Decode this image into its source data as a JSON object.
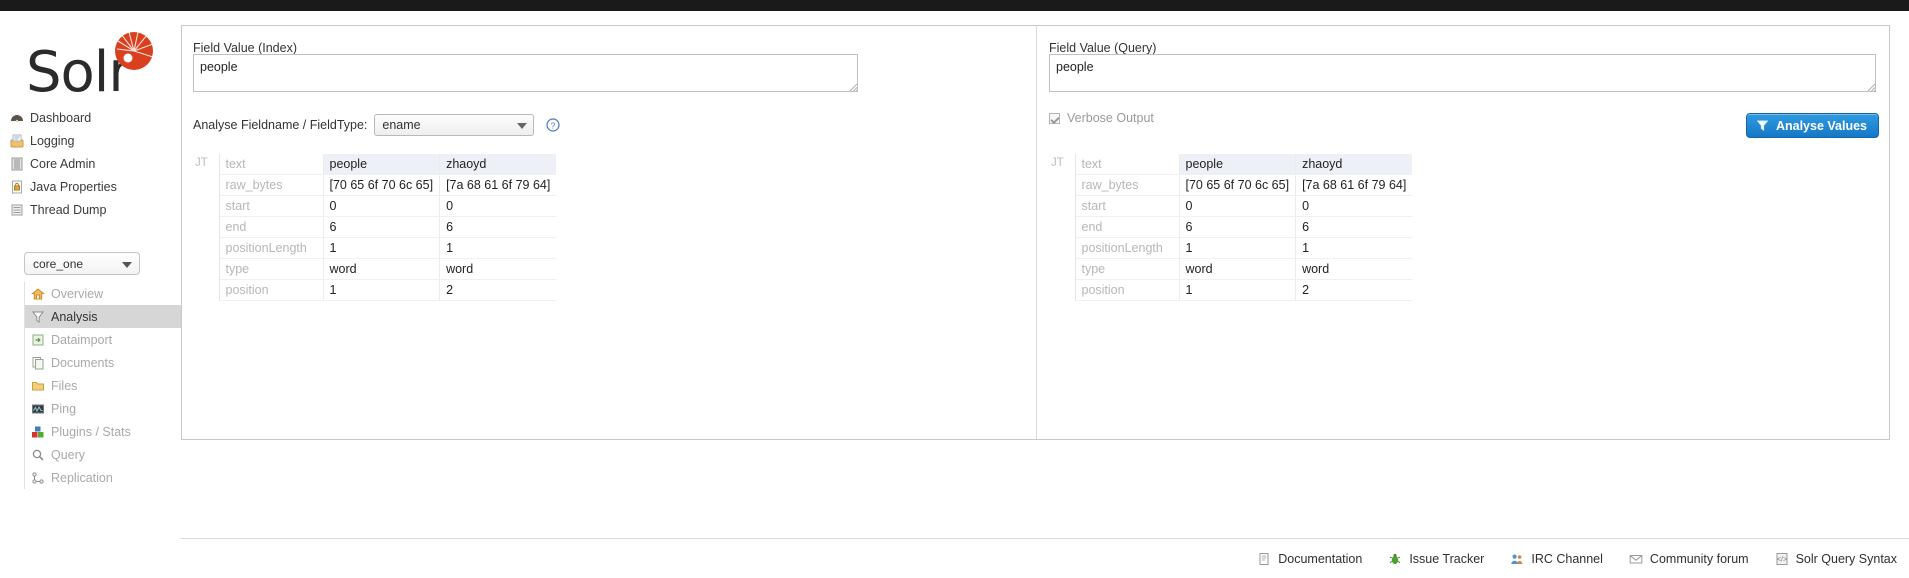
{
  "brand": {
    "name": "Solr",
    "accent": "#d9411e"
  },
  "sidebar": {
    "main_items": [
      {
        "label": "Dashboard",
        "icon": "dashboard-icon"
      },
      {
        "label": "Logging",
        "icon": "logging-icon"
      },
      {
        "label": "Core Admin",
        "icon": "core-admin-icon"
      },
      {
        "label": "Java Properties",
        "icon": "java-properties-icon"
      },
      {
        "label": "Thread Dump",
        "icon": "thread-dump-icon"
      }
    ],
    "core_selector": {
      "value": "core_one"
    },
    "core_items": [
      {
        "label": "Overview",
        "icon": "overview-icon",
        "active": false
      },
      {
        "label": "Analysis",
        "icon": "analysis-icon",
        "active": true
      },
      {
        "label": "Dataimport",
        "icon": "dataimport-icon",
        "active": false
      },
      {
        "label": "Documents",
        "icon": "documents-icon",
        "active": false
      },
      {
        "label": "Files",
        "icon": "files-icon",
        "active": false
      },
      {
        "label": "Ping",
        "icon": "ping-icon",
        "active": false
      },
      {
        "label": "Plugins / Stats",
        "icon": "plugins-icon",
        "active": false
      },
      {
        "label": "Query",
        "icon": "query-icon",
        "active": false
      },
      {
        "label": "Replication",
        "icon": "replication-icon",
        "active": false
      }
    ]
  },
  "index_panel": {
    "label": "Field Value (Index)",
    "value": "people",
    "fieldname_label": "Analyse Fieldname / FieldType:",
    "fieldtype_value": "ename",
    "help_icon": "help-icon"
  },
  "query_panel": {
    "label": "Field Value (Query)",
    "value": "people",
    "verbose_label": "Verbose Output",
    "verbose_checked": true,
    "analyse_button": "Analyse Values",
    "analyse_icon": "funnel-icon"
  },
  "analysis_result": {
    "jt_label": "JT",
    "row_keys": [
      "text",
      "raw_bytes",
      "start",
      "end",
      "positionLength",
      "type",
      "position"
    ],
    "tokens": [
      {
        "text": "people",
        "raw_bytes": "[70 65 6f 70 6c 65]",
        "start": "0",
        "end": "6",
        "positionLength": "1",
        "type": "word",
        "position": "1"
      },
      {
        "text": "zhaoyd",
        "raw_bytes": "[7a 68 61 6f 79 64]",
        "start": "0",
        "end": "6",
        "positionLength": "1",
        "type": "word",
        "position": "2"
      }
    ]
  },
  "footer": {
    "links": [
      {
        "label": "Documentation",
        "icon": "documentation-icon"
      },
      {
        "label": "Issue Tracker",
        "icon": "bug-icon"
      },
      {
        "label": "IRC Channel",
        "icon": "people-icon"
      },
      {
        "label": "Community forum",
        "icon": "mail-icon"
      },
      {
        "label": "Solr Query Syntax",
        "icon": "query-syntax-icon"
      }
    ]
  }
}
